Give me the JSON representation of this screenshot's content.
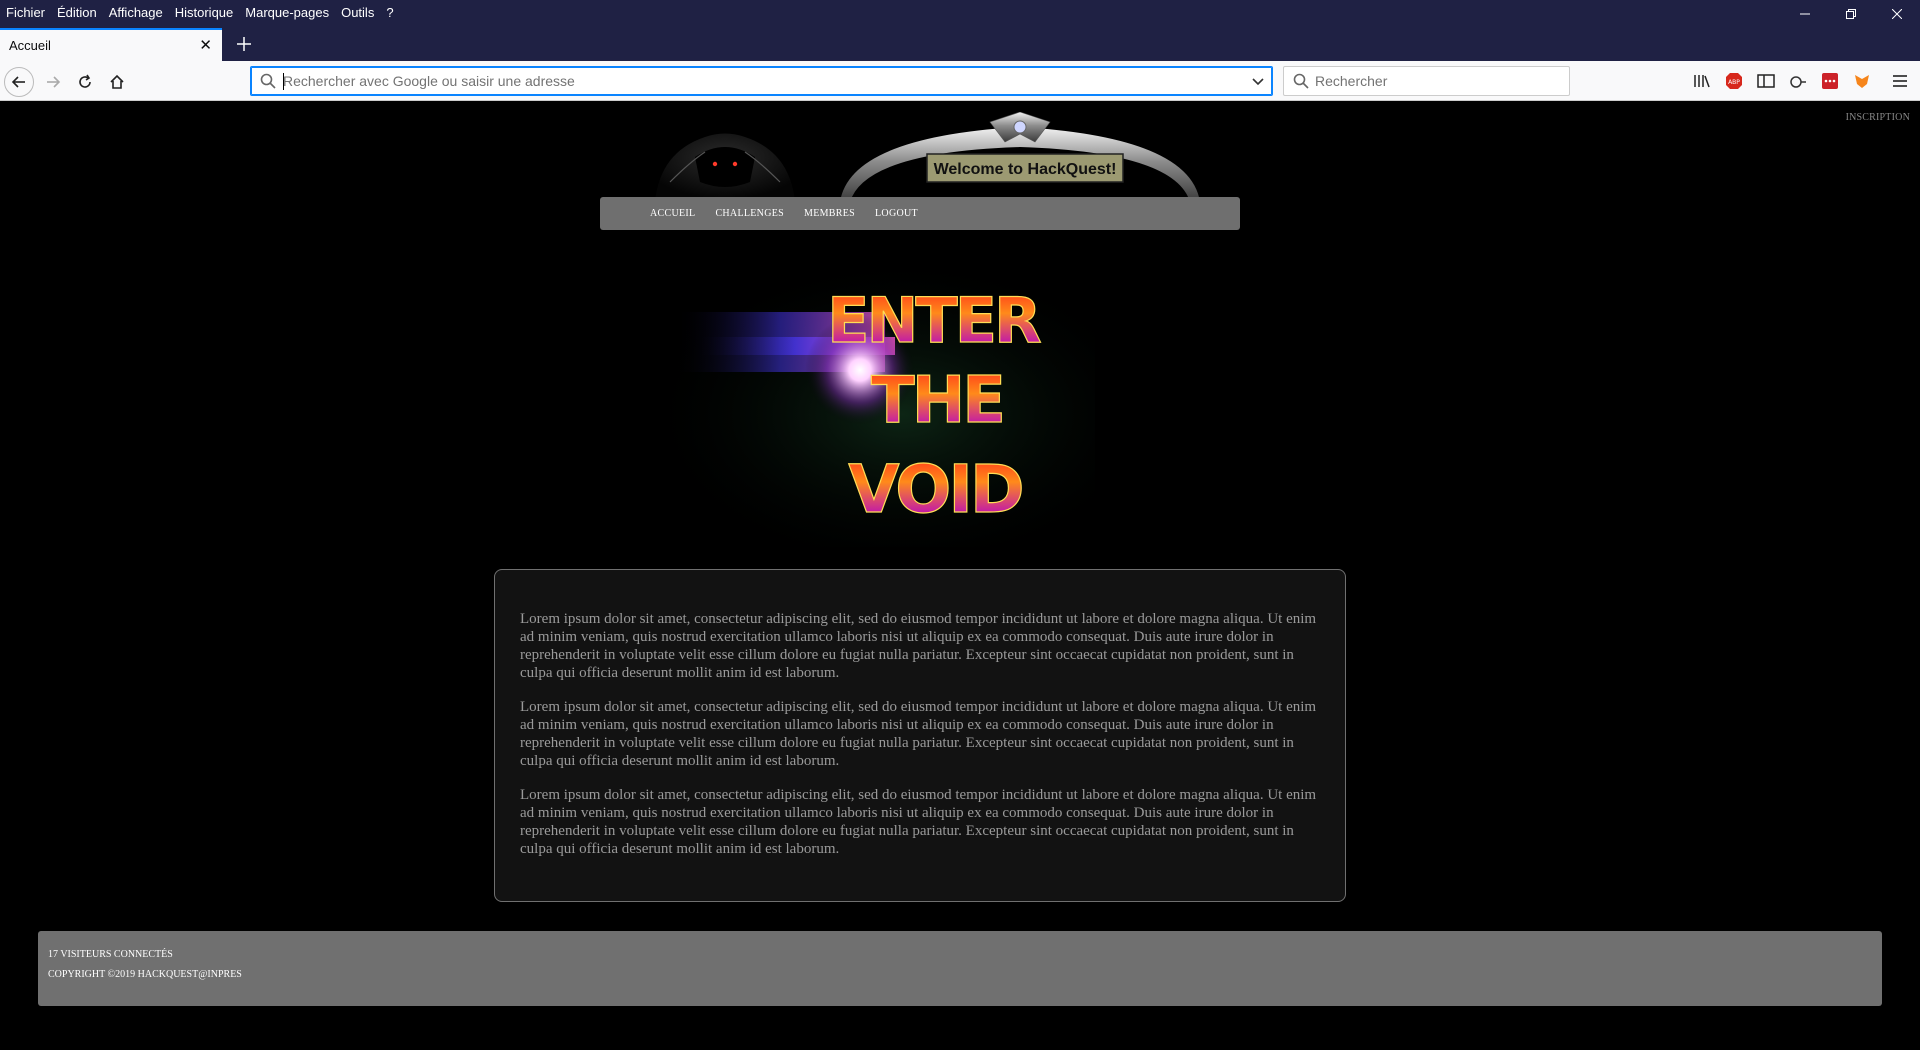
{
  "browser": {
    "menu": [
      "Fichier",
      "Édition",
      "Affichage",
      "Historique",
      "Marque-pages",
      "Outils",
      "?"
    ],
    "tab": {
      "title": "Accueil"
    },
    "urlbar": {
      "placeholder": "Rechercher avec Google ou saisir une adresse"
    },
    "searchbar": {
      "placeholder": "Rechercher"
    },
    "icons": [
      "back-icon",
      "forward-icon",
      "reload-icon",
      "home-icon",
      "library-icon",
      "adblock-icon",
      "sidebar-icon",
      "extension-icon",
      "lastpass-icon",
      "metamask-icon",
      "menu-icon"
    ]
  },
  "site": {
    "inscription": "INSCRIPTION",
    "banner_text": "Welcome to HackQuest!",
    "nav": [
      "ACCUEIL",
      "CHALLENGES",
      "MEMBRES",
      "LOGOUT"
    ],
    "hero_text": [
      "ENTER",
      "THE",
      "VOID"
    ],
    "paragraphs": [
      "Lorem ipsum dolor sit amet, consectetur adipiscing elit, sed do eiusmod tempor incididunt ut labore et dolore magna aliqua. Ut enim ad minim veniam, quis nostrud exercitation ullamco laboris nisi ut aliquip ex ea commodo consequat. Duis aute irure dolor in reprehenderit in voluptate velit esse cillum dolore eu fugiat nulla pariatur. Excepteur sint occaecat cupidatat non proident, sunt in culpa qui officia deserunt mollit anim id est laborum.",
      "Lorem ipsum dolor sit amet, consectetur adipiscing elit, sed do eiusmod tempor incididunt ut labore et dolore magna aliqua. Ut enim ad minim veniam, quis nostrud exercitation ullamco laboris nisi ut aliquip ex ea commodo consequat. Duis aute irure dolor in reprehenderit in voluptate velit esse cillum dolore eu fugiat nulla pariatur. Excepteur sint occaecat cupidatat non proident, sunt in culpa qui officia deserunt mollit anim id est laborum.",
      "Lorem ipsum dolor sit amet, consectetur adipiscing elit, sed do eiusmod tempor incididunt ut labore et dolore magna aliqua. Ut enim ad minim veniam, quis nostrud exercitation ullamco laboris nisi ut aliquip ex ea commodo consequat. Duis aute irure dolor in reprehenderit in voluptate velit esse cillum dolore eu fugiat nulla pariatur. Excepteur sint occaecat cupidatat non proident, sunt in culpa qui officia deserunt mollit anim id est laborum."
    ],
    "footer": {
      "visitors": "17 VISITEURS CONNECTÉS",
      "copyright": "COPYRIGHT ©2019 HACKQUEST@INPRES"
    }
  },
  "colors": {
    "chrome_dark": "#1f2144",
    "accent": "#0a84ff",
    "nav_bg": "#6f6f6f",
    "content_bg": "#121212",
    "text_gray": "#9a9a9a"
  }
}
